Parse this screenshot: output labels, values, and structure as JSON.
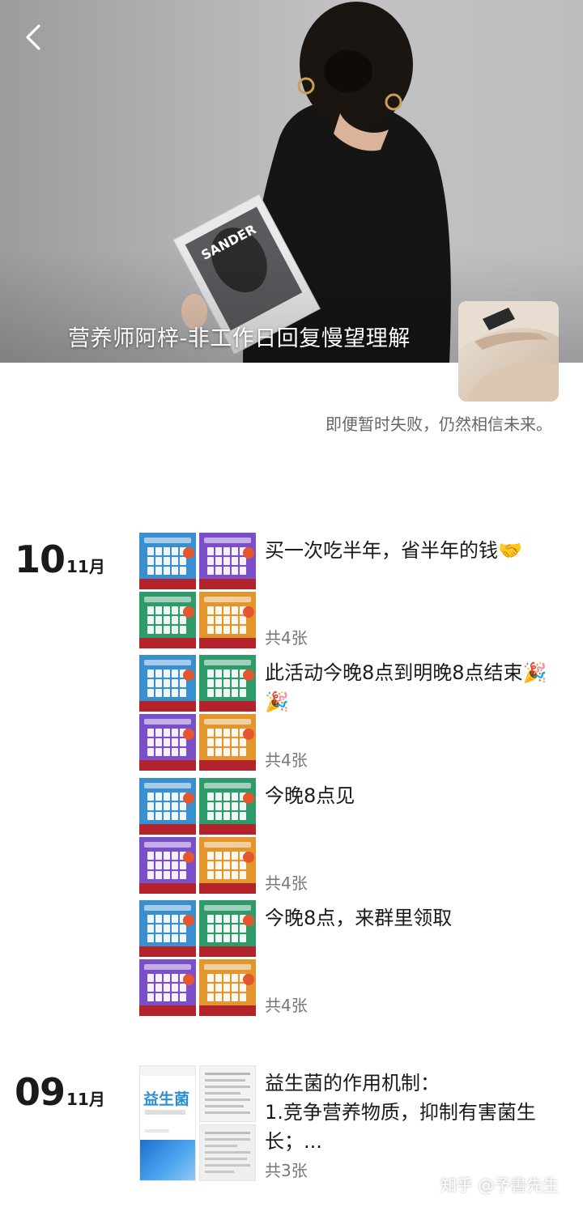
{
  "header": {
    "back_icon": "chevron-left-icon",
    "cover_title": "营养师阿梓-非工作日回复慢望理解",
    "signature": "即便暂时失败，仍然相信未来。"
  },
  "days": [
    {
      "day": "10",
      "month": "11月"
    },
    {
      "day": "09",
      "month": "11月"
    }
  ],
  "posts": [
    {
      "text": "买一次吃半年，省半年的钱🤝",
      "count": "共4张",
      "colors": [
        "#3a8fd0",
        "#7b4fc9",
        "#2f9a6a",
        "#e3962e"
      ]
    },
    {
      "text": "此活动今晚8点到明晚8点结束🎉🎉",
      "count": "共4张",
      "colors": [
        "#3a8fd0",
        "#2f9a6a",
        "#7b4fc9",
        "#e3962e"
      ]
    },
    {
      "text": "今晚8点见",
      "count": "共4张",
      "colors": [
        "#3a8fd0",
        "#2f9a6a",
        "#7b4fc9",
        "#e3962e"
      ]
    },
    {
      "text": "今晚8点，来群里领取",
      "count": "共4张",
      "colors": [
        "#3a8fd0",
        "#2f9a6a",
        "#7b4fc9",
        "#e3962e"
      ]
    },
    {
      "text": "益生菌的作用机制：\n1.竞争营养物质，抑制有害菌生长；...",
      "count": "共3张",
      "colors": [
        "#ffffff",
        "#f2f2f2",
        "#ececec"
      ]
    }
  ],
  "book": {
    "title": "益生菌"
  },
  "watermark": "知乎 @予書先生"
}
